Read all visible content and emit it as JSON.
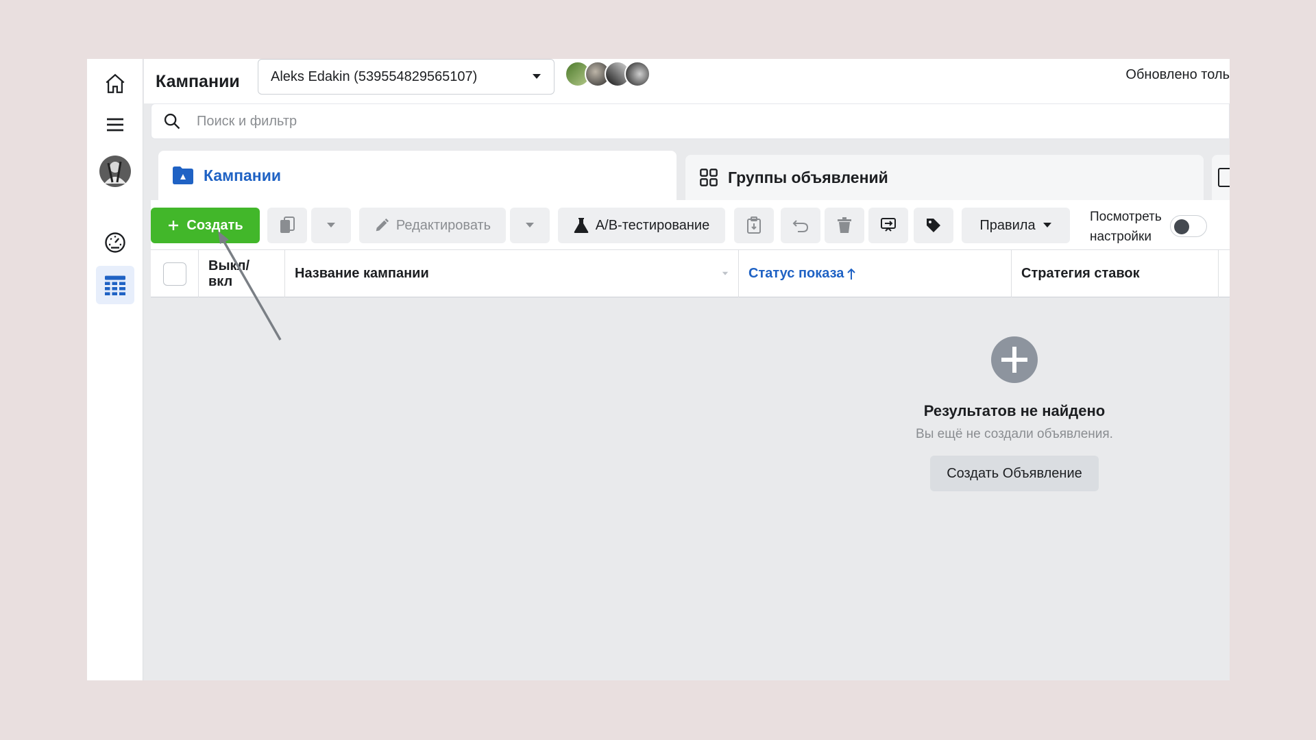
{
  "header": {
    "title": "Кампании",
    "account": "Aleks Edakin (539554829565107)",
    "updated_text": "Обновлено толь"
  },
  "search": {
    "placeholder": "Поиск и фильтр"
  },
  "tabs": [
    {
      "label": "Кампании",
      "active": true
    },
    {
      "label": "Группы объявлений",
      "active": false
    }
  ],
  "toolbar": {
    "create_label": "Создать",
    "edit_label": "Редактировать",
    "ab_label": "A/B-тестирование",
    "rules_label": "Правила",
    "view_settings_line1": "Посмотреть",
    "view_settings_line2": "настройки"
  },
  "table": {
    "columns": [
      "Выкл/\nвкл",
      "Название кампании",
      "Статус показа",
      "Стратегия ставок"
    ],
    "col_onoff_l1": "Выкл/",
    "col_onoff_l2": "вкл",
    "col_name": "Название кампании",
    "col_status": "Статус показа",
    "col_strategy": "Стратегия ставок"
  },
  "empty_state": {
    "title": "Результатов не найдено",
    "subtitle": "Вы ещё не создали объявления.",
    "button": "Создать Объявление"
  },
  "colors": {
    "create_green": "#42b72a",
    "link_blue": "#1f62c4"
  }
}
